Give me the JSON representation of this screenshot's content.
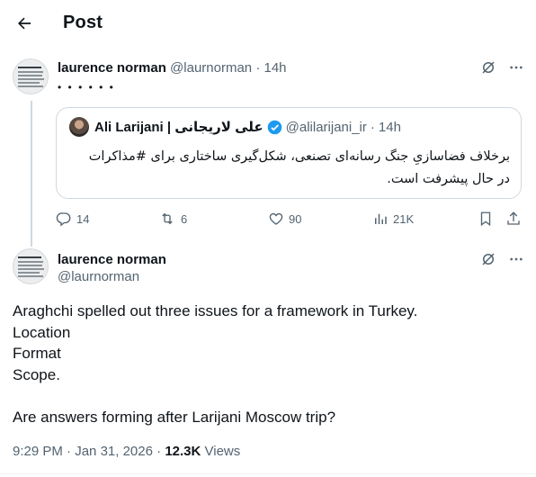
{
  "header": {
    "title": "Post",
    "back_icon": "arrow-left-icon"
  },
  "parent_tweet": {
    "author_name": "laurence norman",
    "author_handle": "@laurnorman",
    "time": "14h",
    "text": "• • • • • •",
    "quoted": {
      "author_name": "Ali Larijani | علی لاریجانی",
      "author_handle": "@alilarijani_ir",
      "time": "14h",
      "text": "برخلاف فضاسازیِ جنگ رسانه‌ای تصنعی، شکل‌گیری ساختاری برای #مذاکرات در حال پیشرفت است."
    },
    "stats": {
      "replies": "14",
      "reposts": "6",
      "likes": "90",
      "views": "21K"
    }
  },
  "main_tweet": {
    "author_name": "laurence norman",
    "author_handle": "@laurnorman",
    "lines": [
      "Araghchi spelled out three issues for a framework in Turkey.",
      "Location",
      "Format",
      "Scope.",
      "",
      "Are answers forming after Larijani Moscow trip?"
    ],
    "time": "9:29 PM",
    "date": "Jan 31, 2026",
    "views_count": "12.3K",
    "views_label": "Views"
  },
  "colors": {
    "text": "#0f1419",
    "muted": "#536471",
    "border": "#cfd9de",
    "verified": "#1d9bf0"
  }
}
